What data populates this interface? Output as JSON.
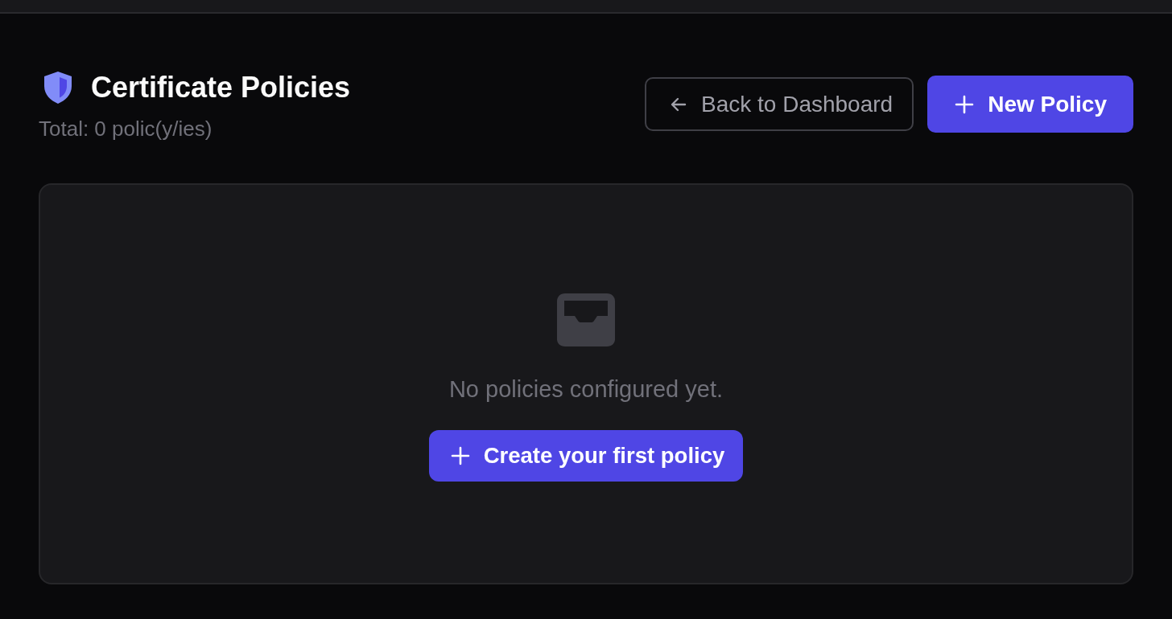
{
  "header": {
    "title": "Certificate Policies",
    "subtitle": "Total: 0 polic(y/ies)"
  },
  "actions": [
    {
      "kind": "secondary",
      "label": "Back to Dashboard"
    },
    {
      "kind": "primary",
      "label": "New Policy"
    }
  ],
  "empty_state": {
    "message": "No policies configured yet.",
    "button": {
      "kind": "primary",
      "label": "Create your first policy"
    }
  }
}
